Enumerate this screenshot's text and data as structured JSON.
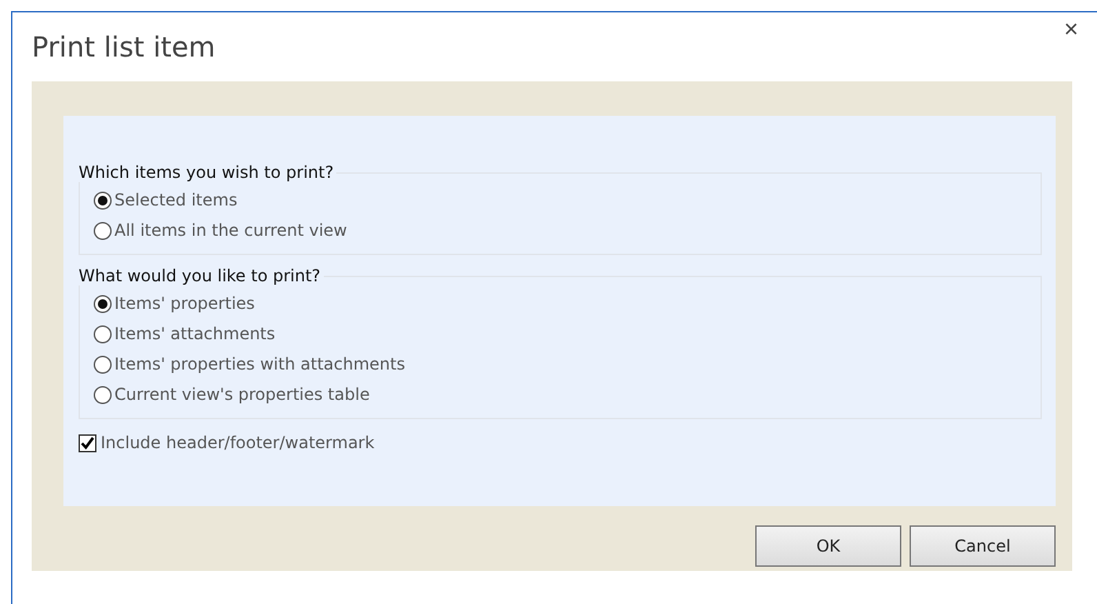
{
  "dialog": {
    "title": "Print list item",
    "close": "×"
  },
  "groups": [
    {
      "legend": "Which items you wish to print?",
      "options": [
        {
          "label": "Selected items",
          "selected": true
        },
        {
          "label": "All items in the current view",
          "selected": false
        }
      ]
    },
    {
      "legend": "What would you like to print?",
      "options": [
        {
          "label": "Items' properties",
          "selected": true
        },
        {
          "label": "Items' attachments",
          "selected": false
        },
        {
          "label": "Items' properties with attachments",
          "selected": false
        },
        {
          "label": "Current view's properties table",
          "selected": false
        }
      ]
    }
  ],
  "include_header": {
    "label": "Include header/footer/watermark",
    "checked": true
  },
  "buttons": [
    "OK",
    "Cancel"
  ]
}
